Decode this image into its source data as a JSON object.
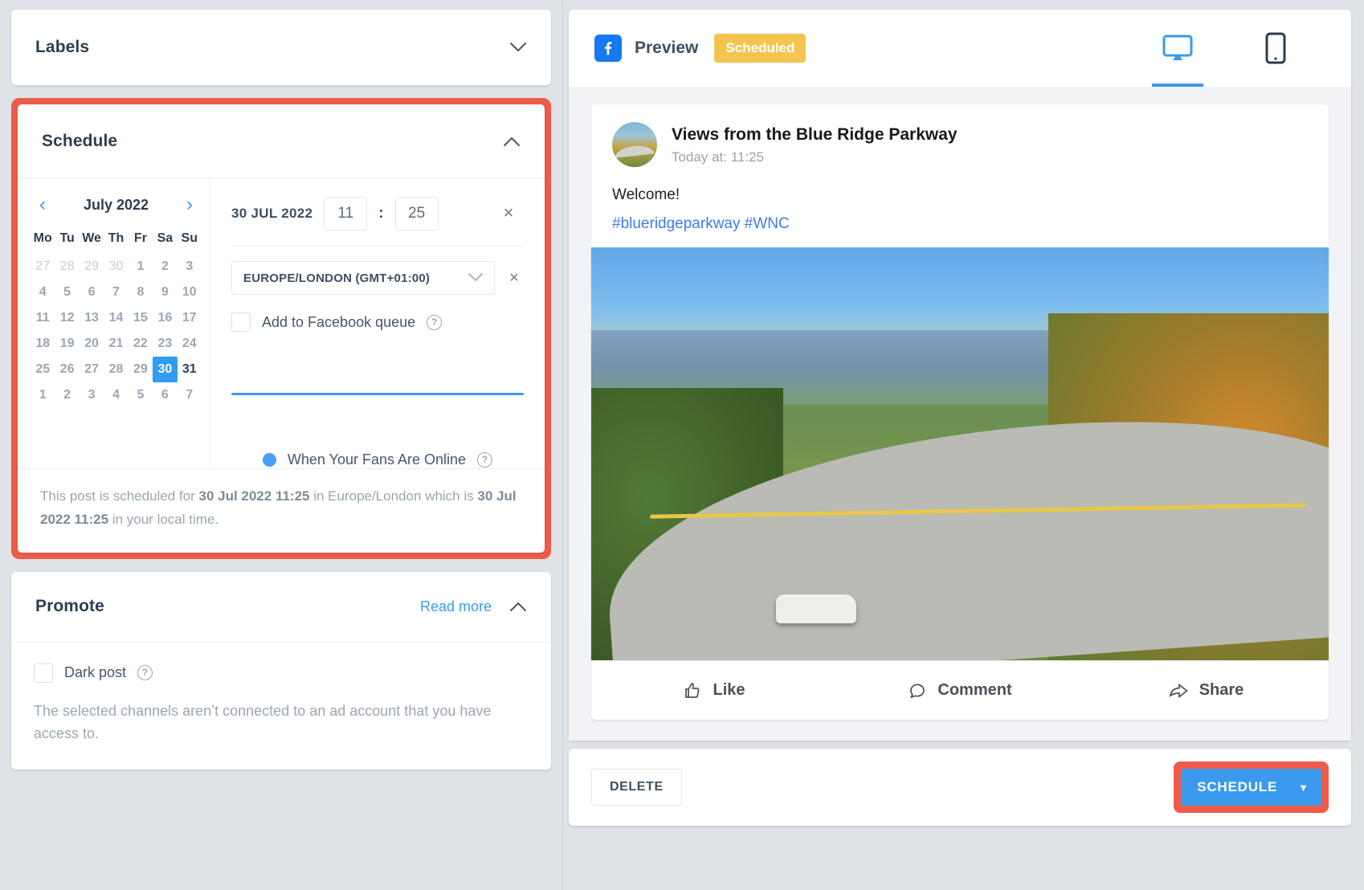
{
  "left": {
    "labels": {
      "title": "Labels",
      "chevron": "chevron-down-icon"
    },
    "schedule": {
      "title": "Schedule",
      "chevron": "chevron-up-icon",
      "calendar": {
        "prev": "‹",
        "next": "›",
        "month": "July 2022",
        "dow": [
          "Mo",
          "Tu",
          "We",
          "Th",
          "Fr",
          "Sa",
          "Su"
        ],
        "weeks": [
          [
            {
              "n": "27",
              "muted": true
            },
            {
              "n": "28",
              "muted": true
            },
            {
              "n": "29",
              "muted": true
            },
            {
              "n": "30",
              "muted": true
            },
            {
              "n": "1"
            },
            {
              "n": "2"
            },
            {
              "n": "3"
            }
          ],
          [
            {
              "n": "4"
            },
            {
              "n": "5"
            },
            {
              "n": "6"
            },
            {
              "n": "7"
            },
            {
              "n": "8"
            },
            {
              "n": "9"
            },
            {
              "n": "10"
            }
          ],
          [
            {
              "n": "11"
            },
            {
              "n": "12"
            },
            {
              "n": "13"
            },
            {
              "n": "14"
            },
            {
              "n": "15"
            },
            {
              "n": "16"
            },
            {
              "n": "17"
            }
          ],
          [
            {
              "n": "18"
            },
            {
              "n": "19"
            },
            {
              "n": "20"
            },
            {
              "n": "21"
            },
            {
              "n": "22"
            },
            {
              "n": "23"
            },
            {
              "n": "24"
            }
          ],
          [
            {
              "n": "25"
            },
            {
              "n": "26"
            },
            {
              "n": "27"
            },
            {
              "n": "28"
            },
            {
              "n": "29"
            },
            {
              "n": "30",
              "selected": true
            },
            {
              "n": "31",
              "dark": true
            }
          ],
          [
            {
              "n": "1"
            },
            {
              "n": "2"
            },
            {
              "n": "3"
            },
            {
              "n": "4"
            },
            {
              "n": "5"
            },
            {
              "n": "6"
            },
            {
              "n": "7"
            }
          ]
        ]
      },
      "date_text": "30 JUL 2022",
      "hour": "11",
      "minute": "25",
      "colon": ":",
      "clear_time": "×",
      "timezone": "EUROPE/LONDON (GMT+01:00)",
      "timezone_clear": "×",
      "queue_checkbox_label": "Add to Facebook queue",
      "queue_checked": false,
      "fans_online_label": "When Your Fans Are Online",
      "note": {
        "part1": "This post is scheduled for ",
        "bold1": "30 Jul 2022 11:25",
        "part2": " in Europe/London which is ",
        "bold2": "30 Jul 2022 11:25",
        "part3": " in your local time."
      },
      "accent_color": "#3b9aed",
      "highlight_color": "#ef5b49",
      "selected_day_color": "#2f9bf3"
    },
    "promote": {
      "title": "Promote",
      "read_more": "Read more",
      "chevron": "chevron-up-icon",
      "dark_post_label": "Dark post",
      "dark_post_checked": false,
      "note": "The selected channels aren’t connected to an ad account that you have access to."
    }
  },
  "right": {
    "preview": {
      "network_icon": "facebook-icon",
      "label": "Preview",
      "status": "Scheduled",
      "status_color": "#f3c54f",
      "desktop_icon": "desktop-monitor-icon",
      "mobile_icon": "mobile-phone-icon",
      "active_device": "desktop"
    },
    "post": {
      "avatar": "page-avatar",
      "title": "Views from the Blue Ridge Parkway",
      "time": "Today at: 11:25",
      "text": "Welcome!",
      "hashtags": "#blueridgeparkway #WNC",
      "photo_alt": "blue-ridge-parkway-photo",
      "actions": [
        {
          "label": "Like",
          "icon": "thumbs-up-icon"
        },
        {
          "label": "Comment",
          "icon": "comment-bubble-icon"
        },
        {
          "label": "Share",
          "icon": "share-arrow-icon"
        }
      ]
    },
    "footer": {
      "delete_label": "DELETE",
      "schedule_label": "SCHEDULE",
      "schedule_caret": "▼",
      "schedule_color": "#3b9aed"
    }
  }
}
